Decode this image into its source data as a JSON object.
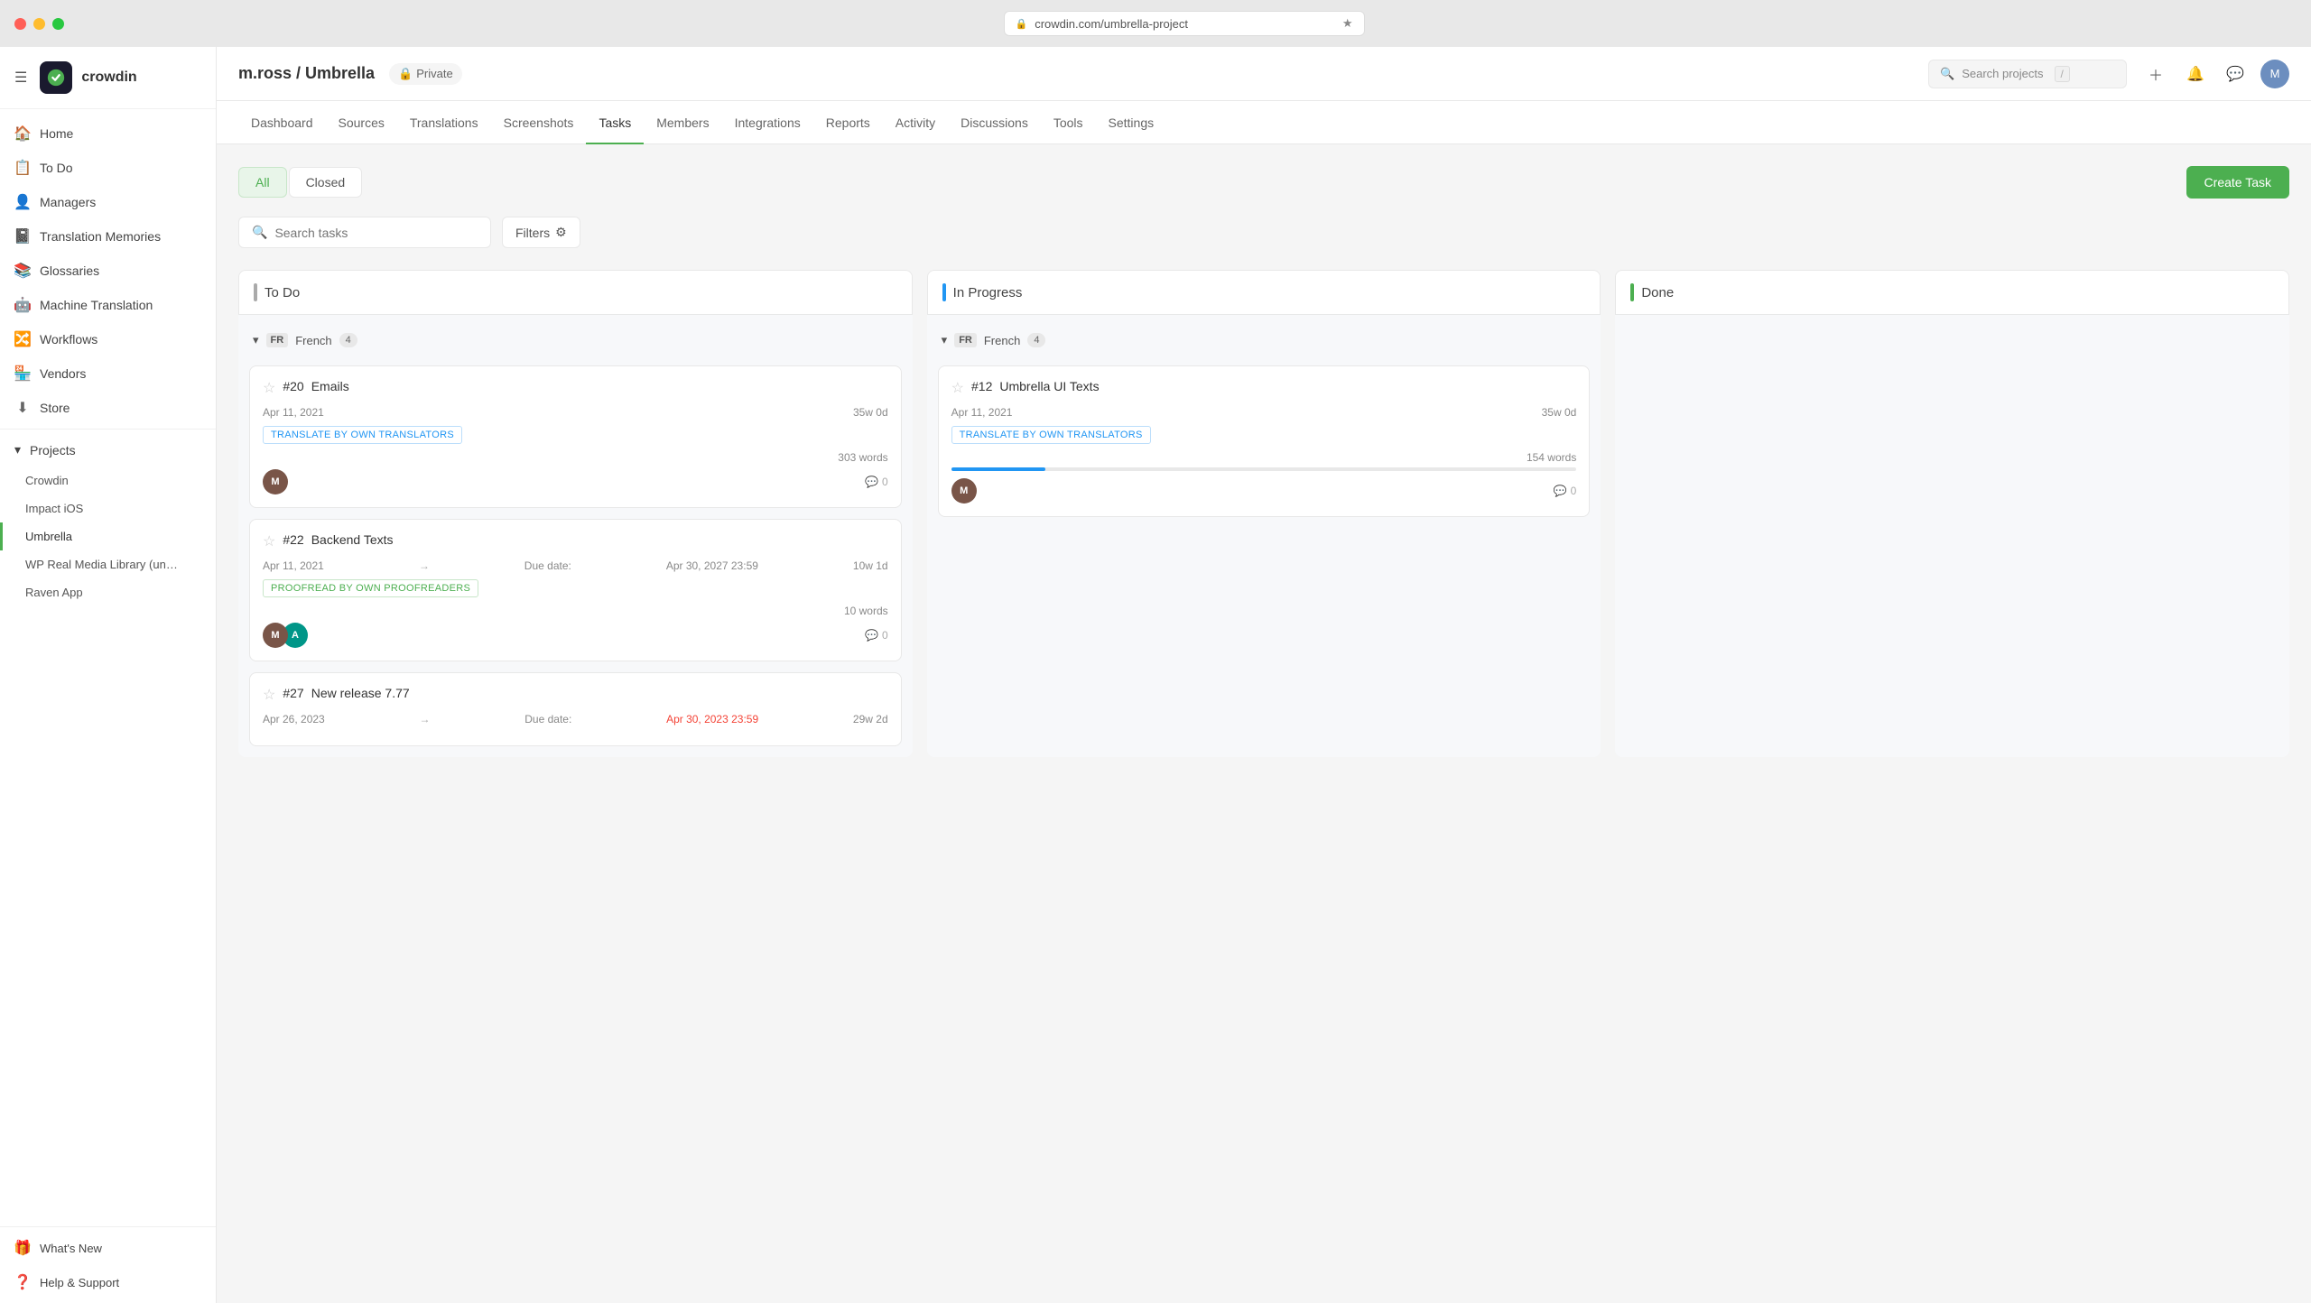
{
  "window": {
    "address": "crowdin.com/umbrella-project"
  },
  "sidebar": {
    "brand": "crowdin",
    "nav_items": [
      {
        "id": "home",
        "label": "Home",
        "icon": "🏠"
      },
      {
        "id": "todo",
        "label": "To Do",
        "icon": "📋"
      },
      {
        "id": "managers",
        "label": "Managers",
        "icon": "👤"
      },
      {
        "id": "translation-memories",
        "label": "Translation Memories",
        "icon": "📓"
      },
      {
        "id": "glossaries",
        "label": "Glossaries",
        "icon": "📚"
      },
      {
        "id": "machine-translation",
        "label": "Machine Translation",
        "icon": "🤖"
      },
      {
        "id": "workflows",
        "label": "Workflows",
        "icon": "🔀"
      },
      {
        "id": "vendors",
        "label": "Vendors",
        "icon": "🏪"
      },
      {
        "id": "store",
        "label": "Store",
        "icon": "⬇"
      }
    ],
    "projects_label": "Projects",
    "projects": [
      {
        "id": "crowdin",
        "label": "Crowdin"
      },
      {
        "id": "impact-ios",
        "label": "Impact iOS"
      },
      {
        "id": "umbrella",
        "label": "Umbrella",
        "active": true
      },
      {
        "id": "wp-real-media",
        "label": "WP Real Media Library (un…"
      },
      {
        "id": "raven-app",
        "label": "Raven App"
      }
    ],
    "bottom_items": [
      {
        "id": "whats-new",
        "label": "What's New",
        "icon": "🎁"
      },
      {
        "id": "help-support",
        "label": "Help & Support",
        "icon": "❓"
      }
    ]
  },
  "topbar": {
    "project_path": "m.ross / Umbrella",
    "privacy": "Private",
    "search_placeholder": "Search projects",
    "slash_hint": "/",
    "tabs": [
      {
        "id": "dashboard",
        "label": "Dashboard"
      },
      {
        "id": "sources",
        "label": "Sources"
      },
      {
        "id": "translations",
        "label": "Translations"
      },
      {
        "id": "screenshots",
        "label": "Screenshots"
      },
      {
        "id": "tasks",
        "label": "Tasks",
        "active": true
      },
      {
        "id": "members",
        "label": "Members"
      },
      {
        "id": "integrations",
        "label": "Integrations"
      },
      {
        "id": "reports",
        "label": "Reports"
      },
      {
        "id": "activity",
        "label": "Activity"
      },
      {
        "id": "discussions",
        "label": "Discussions"
      },
      {
        "id": "tools",
        "label": "Tools"
      },
      {
        "id": "settings",
        "label": "Settings"
      }
    ]
  },
  "tasks_page": {
    "filter_tabs": [
      {
        "id": "all",
        "label": "All",
        "active": true
      },
      {
        "id": "closed",
        "label": "Closed"
      }
    ],
    "create_task_label": "Create Task",
    "search_placeholder": "Search tasks",
    "filters_label": "Filters",
    "columns": [
      {
        "id": "todo",
        "label": "To Do",
        "indicator": "gray",
        "groups": [
          {
            "lang_code": "FR",
            "lang_name": "French",
            "count": 4,
            "tasks": [
              {
                "id": "20",
                "title": "Emails",
                "starred": false,
                "date": "Apr 11, 2021",
                "due_date": null,
                "duration": "35w 0d",
                "tag": "TRANSLATE BY OWN TRANSLATORS",
                "tag_type": "translate",
                "words": "303 words",
                "progress": 0,
                "avatars": [
                  "brown"
                ],
                "comments": 0
              },
              {
                "id": "22",
                "title": "Backend Texts",
                "starred": false,
                "date": "Apr 11, 2021",
                "due_date": "Apr 30, 2027 23:59",
                "duration": "10w 1d",
                "tag": "PROOFREAD BY OWN PROOFREADERS",
                "tag_type": "proofread",
                "words": "10 words",
                "progress": 0,
                "avatars": [
                  "brown",
                  "teal"
                ],
                "comments": 0
              },
              {
                "id": "27",
                "title": "New release 7.77",
                "starred": false,
                "date": "Apr 26, 2023",
                "due_date": "Apr 30, 2023 23:59",
                "due_overdue": true,
                "duration": "29w 2d",
                "tag": null,
                "tag_type": null,
                "words": null,
                "progress": 0,
                "avatars": [],
                "comments": 0
              }
            ]
          }
        ]
      },
      {
        "id": "in-progress",
        "label": "In Progress",
        "indicator": "blue",
        "groups": [
          {
            "lang_code": "FR",
            "lang_name": "French",
            "count": 4,
            "tasks": [
              {
                "id": "12",
                "title": "Umbrella UI Texts",
                "starred": false,
                "date": "Apr 11, 2021",
                "due_date": null,
                "duration": "35w 0d",
                "tag": "TRANSLATE BY OWN TRANSLATORS",
                "tag_type": "translate",
                "words": "154 words",
                "progress": 15,
                "avatars": [
                  "brown"
                ],
                "comments": 0
              }
            ]
          }
        ]
      },
      {
        "id": "done",
        "label": "Done",
        "indicator": "green",
        "groups": []
      }
    ]
  }
}
